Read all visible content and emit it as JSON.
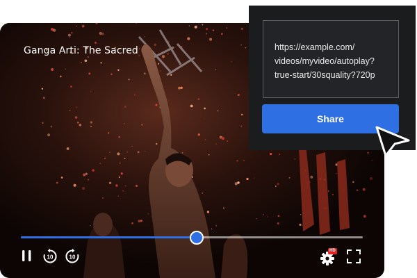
{
  "video": {
    "title": "Ganga Arti: The Sacred",
    "progress": 0.514
  },
  "controls": {
    "pause_icon": "pause-icon",
    "rewind_icon": "rewind-10-icon",
    "forward_icon": "forward-10-icon",
    "rewind_label": "10",
    "forward_label": "10",
    "settings_icon": "gear-icon",
    "quality_badge": "HD",
    "fullscreen_icon": "fullscreen-icon"
  },
  "share": {
    "url_lines": [
      "https://example.com/",
      "videos/myvideo/autoplay?",
      "true-start/30squality?720p"
    ],
    "button_label": "Share"
  },
  "colors": {
    "accent": "#2f6fe4",
    "panel": "#1b1c1e",
    "hd_badge": "#e02424"
  }
}
